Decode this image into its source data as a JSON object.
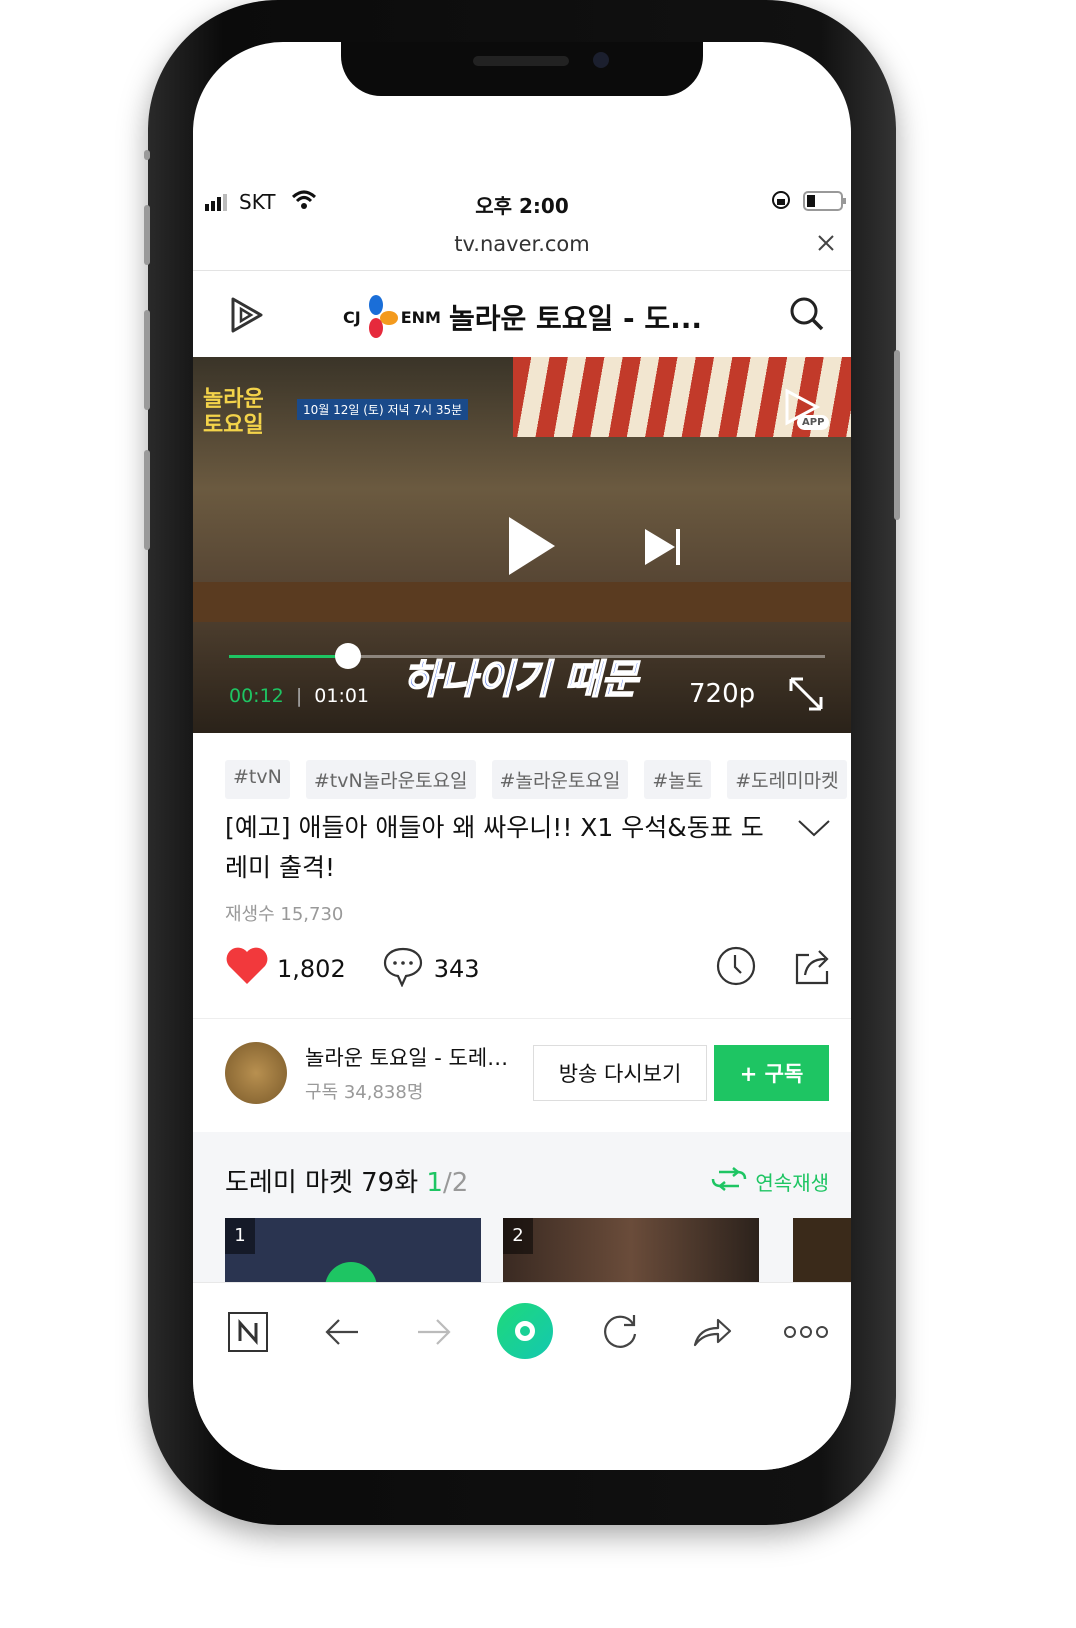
{
  "status_bar": {
    "carrier": "SKT",
    "time": "오후 2:00"
  },
  "browser": {
    "url": "tv.naver.com"
  },
  "header": {
    "brand": "CJ ENM",
    "title": "놀라운 토요일 - 도..."
  },
  "video": {
    "overlay_date": "10월 12일 (토) 저녁 7시 35분",
    "app_badge": "APP",
    "subtitle": "하나이기 때문",
    "current_time": "00:12",
    "duration": "01:01",
    "quality": "720p",
    "progress_percent": 20,
    "accent": "#1ec563"
  },
  "tags": [
    "#tvN",
    "#tvN놀라운토요일",
    "#놀라운토요일",
    "#놀토",
    "#도레미마켓"
  ],
  "clip": {
    "title": "[예고] 애들아 애들아 왜 싸우니!! X1 우석&동표 도레미 출격!",
    "views": "재생수 15,730",
    "likes": "1,802",
    "comments": "343"
  },
  "channel": {
    "name": "놀라운 토요일 - 도레…",
    "subscribers": "구독 34,838명",
    "replay_label": "방송 다시보기",
    "subscribe_label": "+ 구독"
  },
  "playlist": {
    "title": "도레미 마켓 79화",
    "current": "1",
    "separator": "/",
    "total": "2",
    "continuous_label": "연속재생",
    "items": [
      {
        "number": "1"
      },
      {
        "number": "2"
      }
    ]
  }
}
